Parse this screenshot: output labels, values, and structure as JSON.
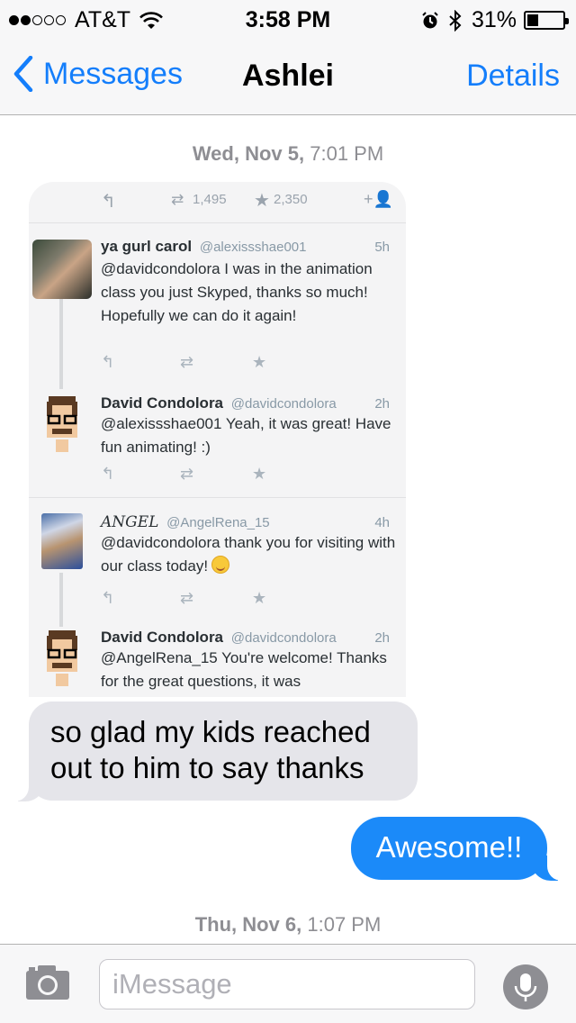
{
  "status_bar": {
    "carrier": "AT&T",
    "time": "3:58 PM",
    "battery_percent": "31%",
    "battery_level": 0.31,
    "signal_bars": 2,
    "signal_total": 5
  },
  "nav": {
    "back_label": "Messages",
    "title": "Ashlei",
    "details_label": "Details"
  },
  "thread": {
    "timestamp1_day": "Wed, Nov 5,",
    "timestamp1_time": "7:01 PM",
    "timestamp2_day": "Thu, Nov 6,",
    "timestamp2_time": "1:07 PM"
  },
  "tweet_image": {
    "retweets": "1,495",
    "favorites": "2,350",
    "tweets": [
      {
        "name": "ya gurl carol",
        "handle": "@alexissshae001",
        "time": "5h",
        "text": "@davidcondolora I was in the animation class you just Skyped, thanks so much! Hopefully we can do it again!"
      },
      {
        "name": "David Condolora",
        "handle": "@davidcondolora",
        "time": "2h",
        "text": "@alexissshae001 Yeah, it was great! Have fun animating! :)"
      },
      {
        "name": "ANGEL",
        "handle": "@AngelRena_15",
        "time": "4h",
        "text": "@davidcondolora thank you for visiting with our class today!"
      },
      {
        "name": "David Condolora",
        "handle": "@davidcondolora",
        "time": "2h",
        "text": "@AngelRena_15 You're welcome! Thanks for the great questions, it was"
      }
    ]
  },
  "messages": {
    "incoming_text": "so glad my kids reached out to him to say thanks",
    "outgoing_text": "Awesome!!"
  },
  "input_bar": {
    "placeholder": "iMessage"
  },
  "colors": {
    "ios_blue": "#147efb",
    "outgoing_bubble": "#1b8af9",
    "incoming_bubble": "#e5e5ea",
    "timestamp_gray": "#8e8e93"
  },
  "icons": {
    "back": "chevron-left-icon",
    "camera": "camera-icon",
    "mic": "microphone-icon",
    "wifi": "wifi-icon",
    "alarm": "alarm-icon",
    "bluetooth": "bluetooth-icon"
  }
}
